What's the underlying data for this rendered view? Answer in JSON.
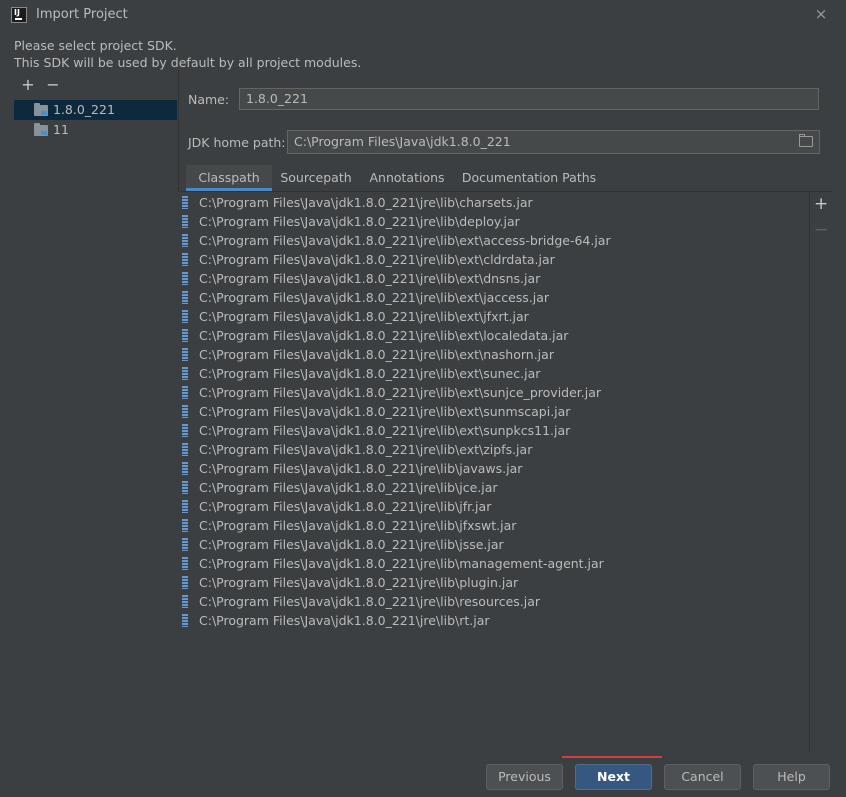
{
  "window": {
    "title": "Import Project",
    "close_glyph": "×"
  },
  "intro": {
    "line1": "Please select project SDK.",
    "line2": "This SDK will be used by default by all project modules."
  },
  "sidebar": {
    "add_glyph": "+",
    "remove_glyph": "−",
    "items": [
      {
        "label": "1.8.0_221",
        "selected": true,
        "icon": "jdk-folder-icon"
      },
      {
        "label": "11",
        "selected": false,
        "icon": "jdk-folder-icon"
      }
    ]
  },
  "form": {
    "name_label": "Name:",
    "name_value": "1.8.0_221",
    "jdk_label": "JDK home path:",
    "jdk_value": "C:\\Program Files\\Java\\jdk1.8.0_221"
  },
  "tabs": [
    {
      "label": "Classpath",
      "active": true
    },
    {
      "label": "Sourcepath",
      "active": false
    },
    {
      "label": "Annotations",
      "active": false
    },
    {
      "label": "Documentation Paths",
      "active": false
    }
  ],
  "classpath": [
    "C:\\Program Files\\Java\\jdk1.8.0_221\\jre\\lib\\charsets.jar",
    "C:\\Program Files\\Java\\jdk1.8.0_221\\jre\\lib\\deploy.jar",
    "C:\\Program Files\\Java\\jdk1.8.0_221\\jre\\lib\\ext\\access-bridge-64.jar",
    "C:\\Program Files\\Java\\jdk1.8.0_221\\jre\\lib\\ext\\cldrdata.jar",
    "C:\\Program Files\\Java\\jdk1.8.0_221\\jre\\lib\\ext\\dnsns.jar",
    "C:\\Program Files\\Java\\jdk1.8.0_221\\jre\\lib\\ext\\jaccess.jar",
    "C:\\Program Files\\Java\\jdk1.8.0_221\\jre\\lib\\ext\\jfxrt.jar",
    "C:\\Program Files\\Java\\jdk1.8.0_221\\jre\\lib\\ext\\localedata.jar",
    "C:\\Program Files\\Java\\jdk1.8.0_221\\jre\\lib\\ext\\nashorn.jar",
    "C:\\Program Files\\Java\\jdk1.8.0_221\\jre\\lib\\ext\\sunec.jar",
    "C:\\Program Files\\Java\\jdk1.8.0_221\\jre\\lib\\ext\\sunjce_provider.jar",
    "C:\\Program Files\\Java\\jdk1.8.0_221\\jre\\lib\\ext\\sunmscapi.jar",
    "C:\\Program Files\\Java\\jdk1.8.0_221\\jre\\lib\\ext\\sunpkcs11.jar",
    "C:\\Program Files\\Java\\jdk1.8.0_221\\jre\\lib\\ext\\zipfs.jar",
    "C:\\Program Files\\Java\\jdk1.8.0_221\\jre\\lib\\javaws.jar",
    "C:\\Program Files\\Java\\jdk1.8.0_221\\jre\\lib\\jce.jar",
    "C:\\Program Files\\Java\\jdk1.8.0_221\\jre\\lib\\jfr.jar",
    "C:\\Program Files\\Java\\jdk1.8.0_221\\jre\\lib\\jfxswt.jar",
    "C:\\Program Files\\Java\\jdk1.8.0_221\\jre\\lib\\jsse.jar",
    "C:\\Program Files\\Java\\jdk1.8.0_221\\jre\\lib\\management-agent.jar",
    "C:\\Program Files\\Java\\jdk1.8.0_221\\jre\\lib\\plugin.jar",
    "C:\\Program Files\\Java\\jdk1.8.0_221\\jre\\lib\\resources.jar",
    "C:\\Program Files\\Java\\jdk1.8.0_221\\jre\\lib\\rt.jar"
  ],
  "list_actions": {
    "add_glyph": "+",
    "remove_glyph": "−"
  },
  "buttons": {
    "previous": "Previous",
    "next": "Next",
    "cancel": "Cancel",
    "help": "Help"
  },
  "colors": {
    "background": "#3c3f41",
    "selection": "#0d293e",
    "accent": "#4a88c7",
    "primary_button": "#365880"
  }
}
